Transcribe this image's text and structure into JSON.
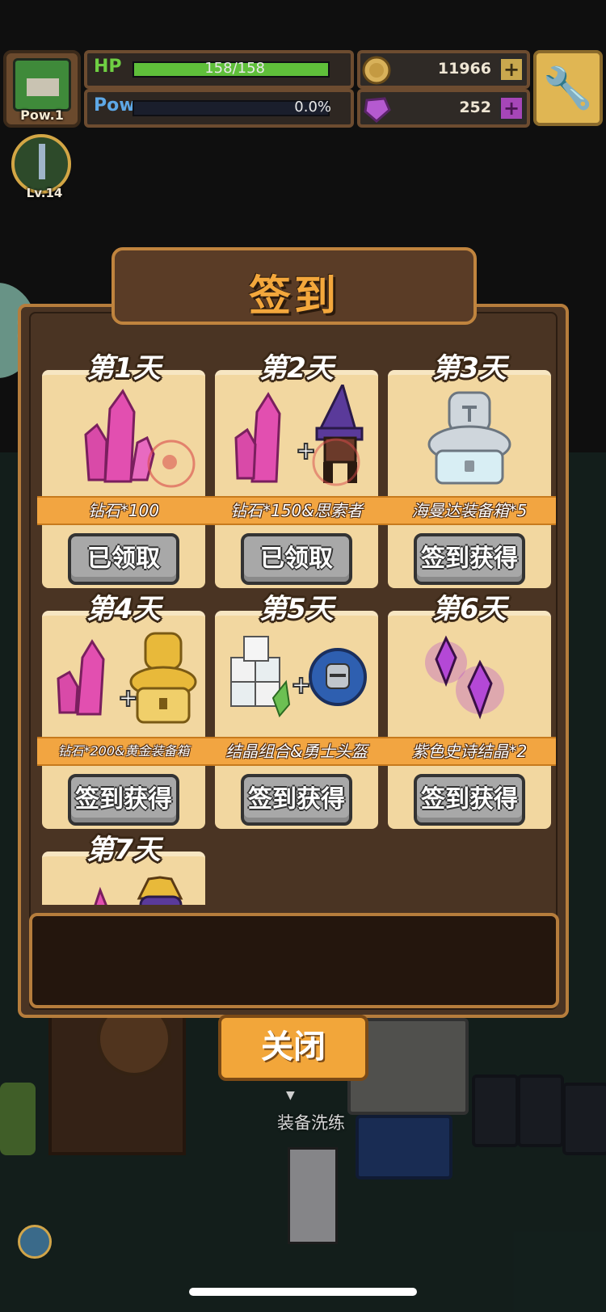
{
  "hud": {
    "player_level": "Pow.1",
    "hp_label": "HP",
    "hp_value": "158/158",
    "hp_fraction": 1.0,
    "pow_label": "Pow",
    "pow_value": "0.0%",
    "pow_fraction": 0.0,
    "gold": "11966",
    "gems": "252",
    "skill_level": "Lv.14"
  },
  "panel": {
    "title": "签到",
    "days": [
      {
        "day": "第1天",
        "reward": "钻石*100",
        "button": "已领取",
        "icon": "pink-crystal-icon"
      },
      {
        "day": "第2天",
        "reward": "钻石*150&思索者",
        "button": "已领取",
        "icon": "crystal-and-wizard-icon"
      },
      {
        "day": "第3天",
        "reward": "海曼达装备箱*5",
        "button": "签到获得",
        "icon": "silver-armor-chest-icon"
      },
      {
        "day": "第4天",
        "reward": "钻石*200&黄金装备箱",
        "button": "签到获得",
        "icon": "crystal-and-gold-chest-icon"
      },
      {
        "day": "第5天",
        "reward": "结晶组合&勇士头盔",
        "button": "签到获得",
        "icon": "crystal-combo-and-helmet-icon"
      },
      {
        "day": "第6天",
        "reward": "紫色史诗结晶*2",
        "button": "签到获得",
        "icon": "purple-crystal-icon"
      },
      {
        "day": "第7天",
        "reward": "",
        "button": "",
        "icon": "crystal-and-cat-icon"
      }
    ],
    "close_label": "关闭"
  },
  "background": {
    "station_label": "装备洗练"
  },
  "colors": {
    "accent_orange": "#f2a541",
    "hp_green": "#5fbf3a",
    "panel_brown": "#4a3423",
    "card_tan": "#f2d7a0"
  }
}
